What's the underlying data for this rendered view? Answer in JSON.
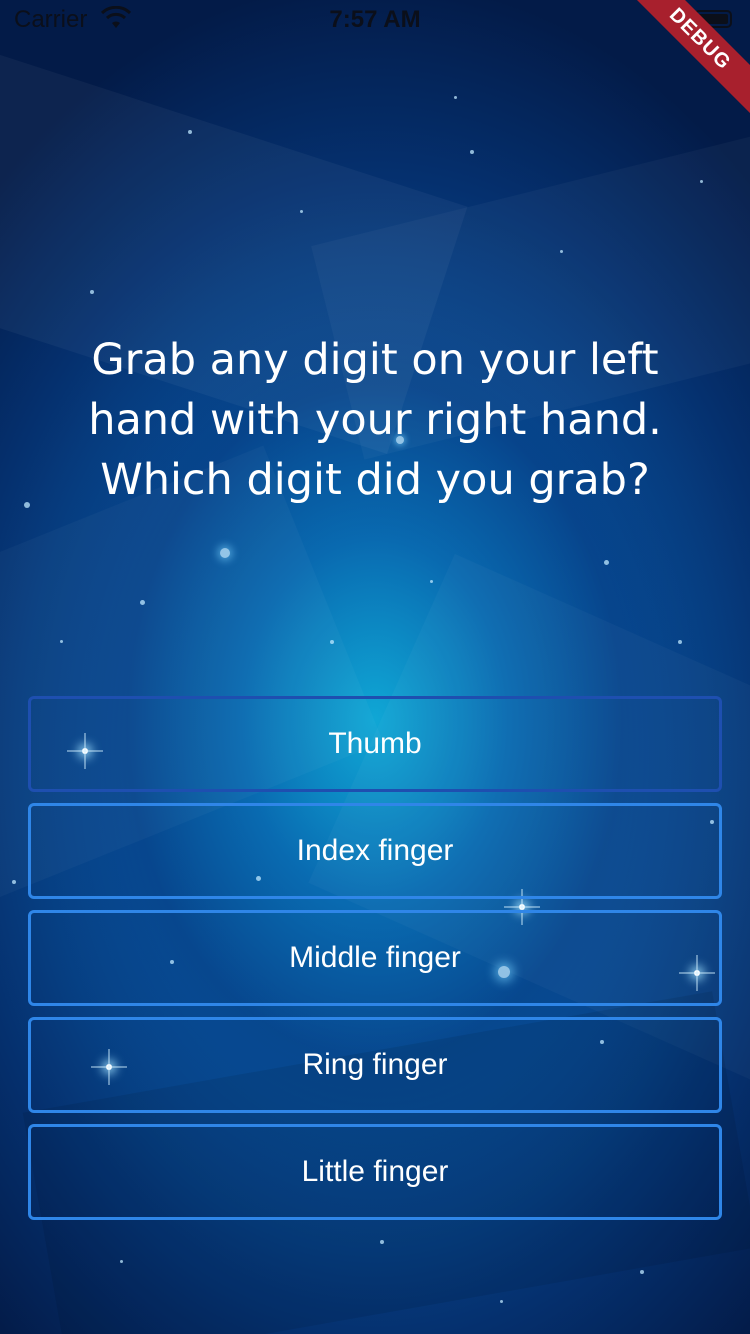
{
  "status_bar": {
    "carrier": "Carrier",
    "time": "7:57 AM",
    "icons": [
      "wifi-icon",
      "battery-icon"
    ]
  },
  "debug_banner": "DEBUG",
  "question": {
    "line1": "Grab any digit on your left",
    "line2": "hand with your right hand.",
    "line3": "Which digit did you grab?"
  },
  "answers": [
    {
      "label": "Thumb"
    },
    {
      "label": "Index finger"
    },
    {
      "label": "Middle finger"
    },
    {
      "label": "Ring finger"
    },
    {
      "label": "Little finger"
    }
  ],
  "colors": {
    "background_center": "#10aad7",
    "background_edge": "#031b48",
    "button_border": "#2f86e8",
    "debug_ribbon": "#a8202d",
    "text": "#ffffff"
  }
}
